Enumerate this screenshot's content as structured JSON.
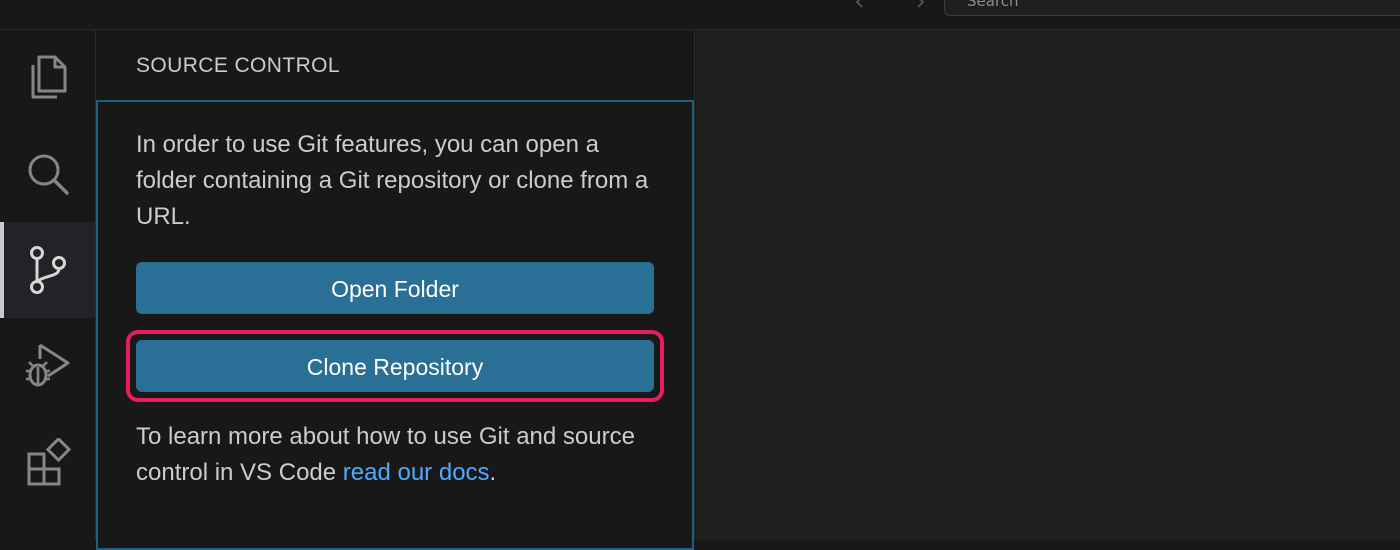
{
  "titlebar": {
    "search_text": "Search",
    "back_icon": "chevron-left-icon",
    "forward_icon": "chevron-right-icon"
  },
  "activity_bar": {
    "items": [
      {
        "name": "explorer",
        "icon": "files-icon",
        "active": false
      },
      {
        "name": "search",
        "icon": "search-icon",
        "active": false
      },
      {
        "name": "source-control",
        "icon": "source-control-icon",
        "active": true
      },
      {
        "name": "run-and-debug",
        "icon": "run-debug-icon",
        "active": false
      },
      {
        "name": "extensions",
        "icon": "extensions-icon",
        "active": false
      }
    ]
  },
  "sidebar": {
    "title": "SOURCE CONTROL",
    "intro_text": "In order to use Git features, you can open a folder containing a Git repository or clone from a URL.",
    "open_folder_label": "Open Folder",
    "clone_repo_label": "Clone Repository",
    "learn_text": "To learn more about how to use Git and source control in VS Code ",
    "docs_link_text": "read our docs",
    "learn_suffix": "."
  },
  "colors": {
    "button_bg": "#2a6f96",
    "link": "#4daafc",
    "highlight": "#e81d5c",
    "focus_border": "#1f5f85"
  }
}
